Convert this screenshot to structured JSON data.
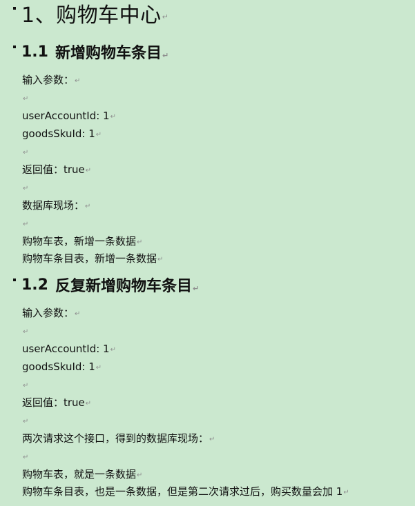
{
  "document": {
    "section1": {
      "title": "1、购物车中心"
    },
    "section1_1": {
      "number": "1.1",
      "title": "新增购物车条目",
      "lines": [
        "输入参数：",
        "",
        "userAccountId: 1",
        "goodsSkuId: 1",
        "",
        "返回值：true",
        "",
        "数据库现场：",
        "",
        "购物车表，新增一条数据",
        "购物车条目表，新增一条数据"
      ]
    },
    "section1_2": {
      "number": "1.2",
      "title": "反复新增购物车条目",
      "lines": [
        "输入参数：",
        "",
        "userAccountId: 1",
        "goodsSkuId: 1",
        "",
        "返回值：true",
        "",
        "两次请求这个接口，得到的数据库现场：",
        "",
        "购物车表，就是一条数据",
        "购物车条目表，也是一条数据，但是第二次请求过后，购买数量会加 1"
      ]
    }
  },
  "colors": {
    "background": "#cbe8cf",
    "text": "#111111",
    "paragraph_mark": "#8f8f8f"
  }
}
